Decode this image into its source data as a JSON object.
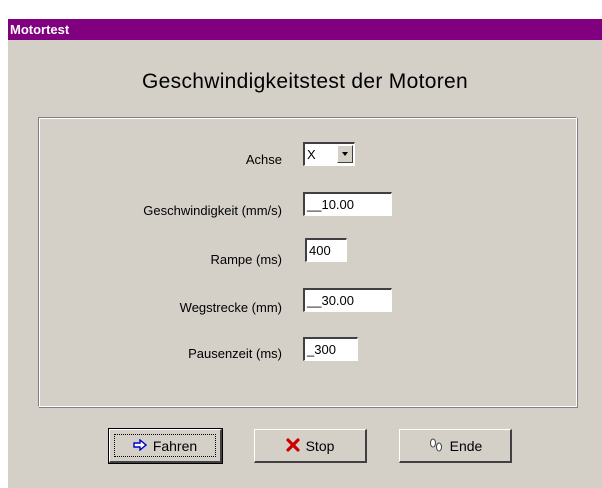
{
  "window": {
    "title": "Motortest"
  },
  "main": {
    "heading": "Geschwindigkeitstest der Motoren"
  },
  "form": {
    "achse_label": "Achse",
    "achse_value": "X",
    "geschwindigkeit_label": "Geschwindigkeit (mm/s)",
    "geschwindigkeit_value": "__10.00",
    "rampe_label": "Rampe (ms)",
    "rampe_value": "400",
    "wegstrecke_label": "Wegstrecke (mm)",
    "wegstrecke_value": "__30.00",
    "pausenzeit_label": "Pausenzeit (ms)",
    "pausenzeit_value": "_300"
  },
  "buttons": {
    "fahren_label": "Fahren",
    "stop_label": "Stop",
    "ende_label": "Ende",
    "fahren_icon": "arrow-right-icon",
    "stop_icon": "red-x-icon",
    "ende_icon": "footprints-icon"
  },
  "colors": {
    "titlebar": "#800080",
    "face": "#d4d0c8",
    "stop_icon": "#cc0000",
    "fahren_icon": "#0000cc"
  }
}
